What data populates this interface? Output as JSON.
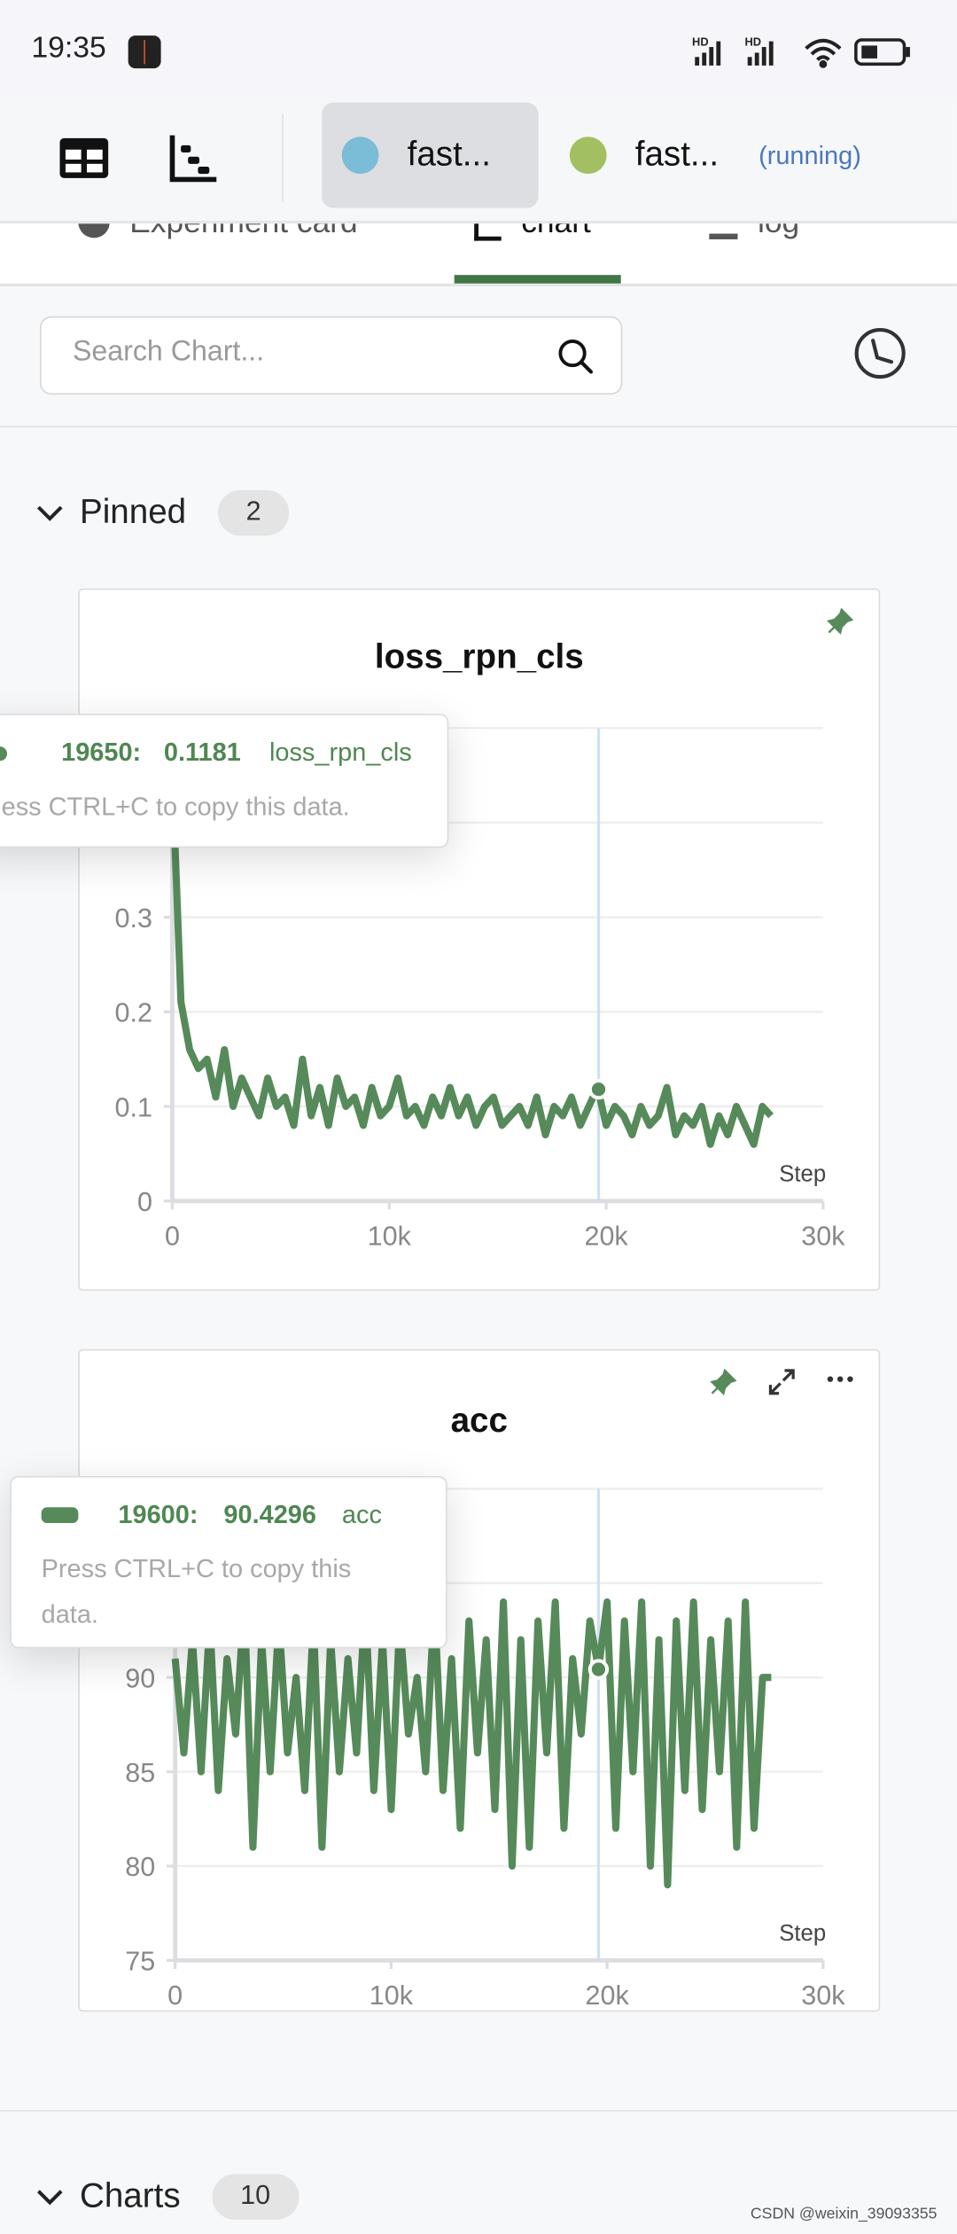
{
  "status_bar": {
    "time": "19:35",
    "icons": [
      "hd-signal-icon",
      "hd-signal-icon",
      "wifi-icon",
      "battery-icon"
    ]
  },
  "toolbar": {
    "icons": [
      "table-view-icon",
      "chart-view-icon"
    ],
    "experiments": [
      {
        "name": "fast...",
        "color": "#7bbcd7",
        "selected": true
      },
      {
        "name": "fast...",
        "color": "#a2c061",
        "status": "(running)"
      }
    ]
  },
  "tabs": [
    {
      "label": "Experiment card",
      "icon": "info-icon"
    },
    {
      "label": "chart",
      "icon": "chart-icon",
      "active": true
    },
    {
      "label": "log",
      "icon": "list-icon"
    }
  ],
  "search": {
    "placeholder": "Search Chart...",
    "value": ""
  },
  "groups": {
    "pinned": {
      "label": "Pinned",
      "count": "2"
    },
    "charts": {
      "label": "Charts",
      "count": "10"
    }
  },
  "accent_color": "#568a5a",
  "watermark": "CSDN @weixin_39093355",
  "chart_data": [
    {
      "type": "line",
      "title": "loss_rpn_cls",
      "xlabel": "Step",
      "xlim": [
        0,
        30000
      ],
      "ylim": [
        0,
        0.5
      ],
      "xticks": [
        "0",
        "10k",
        "20k",
        "30k"
      ],
      "xtick_values": [
        0,
        10000,
        20000,
        30000
      ],
      "yticks": [
        "0",
        "0.1",
        "0.2",
        "0.3"
      ],
      "ytick_values": [
        0,
        0.1,
        0.2,
        0.3
      ],
      "grid_values": [
        0,
        0.1,
        0.2,
        0.3,
        0.4,
        0.5
      ],
      "color": "#568a5a",
      "x": [
        0,
        400,
        800,
        1200,
        1600,
        2000,
        2400,
        2800,
        3200,
        3600,
        4000,
        4400,
        4800,
        5200,
        5600,
        6000,
        6400,
        6800,
        7200,
        7600,
        8000,
        8400,
        8800,
        9200,
        9600,
        10000,
        10400,
        10800,
        11200,
        11600,
        12000,
        12400,
        12800,
        13200,
        13600,
        14000,
        14400,
        14800,
        15200,
        15600,
        16000,
        16400,
        16800,
        17200,
        17600,
        18000,
        18400,
        18800,
        19200,
        19600,
        20000,
        20400,
        20800,
        21200,
        21600,
        22000,
        22400,
        22800,
        23200,
        23600,
        24000,
        24400,
        24800,
        25200,
        25600,
        26000,
        26400,
        26800,
        27200,
        27600
      ],
      "y": [
        0.45,
        0.21,
        0.16,
        0.14,
        0.15,
        0.11,
        0.16,
        0.1,
        0.13,
        0.11,
        0.09,
        0.13,
        0.1,
        0.11,
        0.08,
        0.15,
        0.09,
        0.12,
        0.08,
        0.13,
        0.1,
        0.11,
        0.08,
        0.12,
        0.09,
        0.1,
        0.13,
        0.09,
        0.1,
        0.08,
        0.11,
        0.09,
        0.12,
        0.09,
        0.11,
        0.08,
        0.1,
        0.11,
        0.08,
        0.09,
        0.1,
        0.08,
        0.11,
        0.07,
        0.1,
        0.09,
        0.11,
        0.08,
        0.1,
        0.12,
        0.08,
        0.1,
        0.09,
        0.07,
        0.1,
        0.08,
        0.09,
        0.12,
        0.07,
        0.09,
        0.08,
        0.1,
        0.06,
        0.09,
        0.07,
        0.1,
        0.08,
        0.06,
        0.1,
        0.09
      ],
      "hover": {
        "step": 19650,
        "value": 0.1181,
        "step_label": "19650:",
        "value_label": "0.1181",
        "series": "loss_rpn_cls",
        "hint": "ess CTRL+C to copy this data."
      },
      "pinned": true
    },
    {
      "type": "line",
      "title": "acc",
      "xlabel": "Step",
      "xlim": [
        0,
        30000
      ],
      "ylim": [
        75,
        100
      ],
      "xticks": [
        "0",
        "10k",
        "20k",
        "30k"
      ],
      "xtick_values": [
        0,
        10000,
        20000,
        30000
      ],
      "yticks": [
        "75",
        "80",
        "85",
        "90"
      ],
      "ytick_values": [
        75,
        80,
        85,
        90
      ],
      "grid_values": [
        75,
        80,
        85,
        90,
        95,
        100
      ],
      "color": "#568a5a",
      "x": [
        0,
        400,
        800,
        1200,
        1600,
        2000,
        2400,
        2800,
        3200,
        3600,
        4000,
        4400,
        4800,
        5200,
        5600,
        6000,
        6400,
        6800,
        7200,
        7600,
        8000,
        8400,
        8800,
        9200,
        9600,
        10000,
        10400,
        10800,
        11200,
        11600,
        12000,
        12400,
        12800,
        13200,
        13600,
        14000,
        14400,
        14800,
        15200,
        15600,
        16000,
        16400,
        16800,
        17200,
        17600,
        18000,
        18400,
        18800,
        19200,
        19600,
        20000,
        20400,
        20800,
        21200,
        21600,
        22000,
        22400,
        22800,
        23200,
        23600,
        24000,
        24400,
        24800,
        25200,
        25600,
        26000,
        26400,
        26800,
        27200,
        27600
      ],
      "y": [
        91,
        86,
        92,
        85,
        93,
        84,
        91,
        87,
        94,
        81,
        92,
        85,
        93,
        86,
        90,
        84,
        93,
        81,
        92,
        85,
        91,
        86,
        94,
        84,
        92,
        83,
        93,
        87,
        90,
        85,
        94,
        84,
        91,
        82,
        93,
        86,
        92,
        83,
        94,
        80,
        92,
        81,
        93,
        86,
        94,
        82,
        91,
        87,
        93,
        90.43,
        94,
        82,
        93,
        85,
        94,
        80,
        92,
        79,
        93,
        84,
        94,
        83,
        92,
        85,
        93,
        81,
        94,
        82,
        90,
        90
      ],
      "hover": {
        "step": 19600,
        "value": 90.4296,
        "step_label": "19600:",
        "value_label": "90.4296",
        "series": "acc",
        "hint": "Press CTRL+C to copy this data."
      },
      "pinned": true
    }
  ]
}
